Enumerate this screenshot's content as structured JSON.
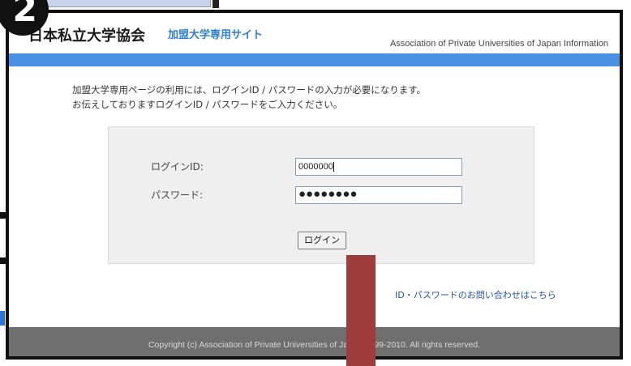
{
  "step_badge": "2",
  "header": {
    "title": "日本私立大学協会",
    "member_link": "加盟大学専用サイト",
    "subtitle": "Association of Private Universities of Japan Information"
  },
  "intro": {
    "line1": "加盟大学専用ページの利用には、ログインID / パスワードの入力が必要になります。",
    "line2": "お伝えしておりますログインID / パスワードをご入力ください。"
  },
  "login": {
    "id_label": "ログインID:",
    "id_value": "0000000",
    "password_label": "パスワード:",
    "password_value": "●●●●●●●●",
    "button_label": "ログイン"
  },
  "help_link": "ID・パスワードのお問い合わせはこちら",
  "footer": {
    "copyright": "Copyright (c) Association of Private Universities of Japan 1999-2010. All rights reserved."
  },
  "colors": {
    "accent_blue": "#4a91e6",
    "link_blue": "#2d7fd3",
    "footer_gray": "#6f6f6f",
    "annotation_red": "#9e3b3b"
  }
}
